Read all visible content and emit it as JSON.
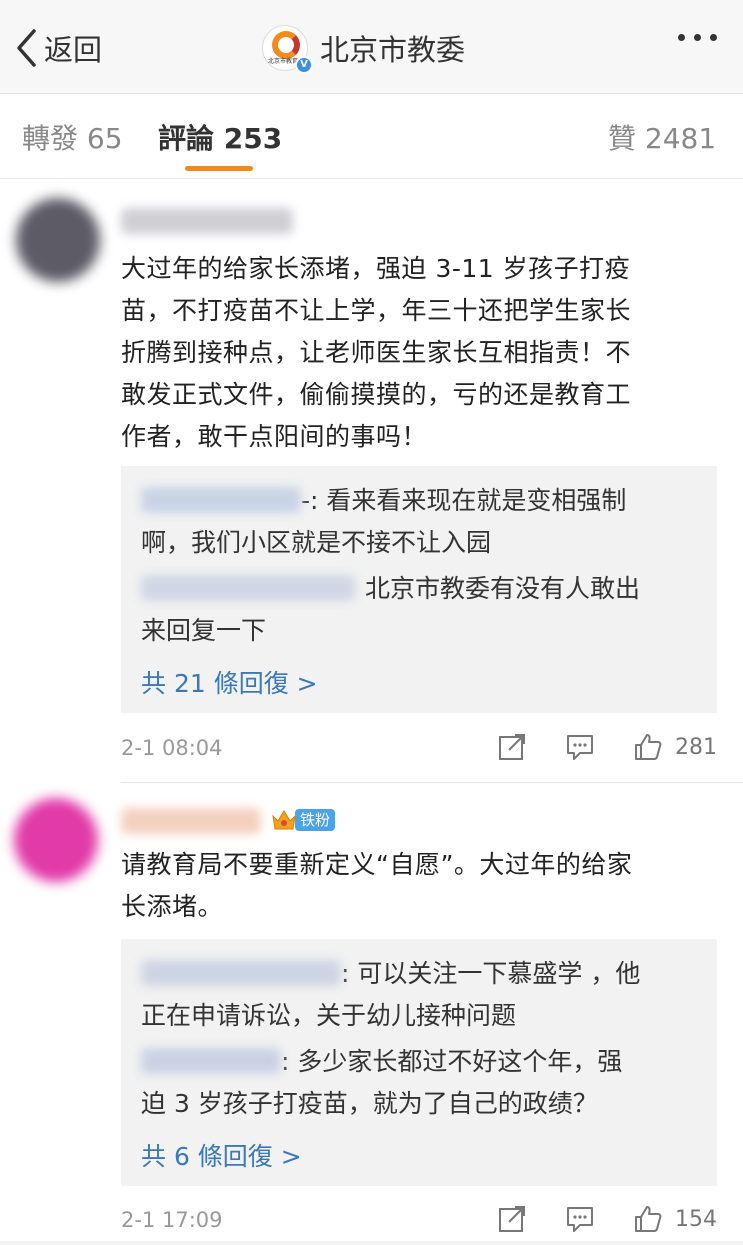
{
  "nav": {
    "back_label": "返回",
    "title": "北京市教委",
    "logo_caption": "北京市教育委",
    "verified_mark": "V"
  },
  "tabs": [
    {
      "label": "轉發",
      "count": "65"
    },
    {
      "label": "評論",
      "count": "253"
    },
    {
      "label": "贊",
      "count": "2481"
    }
  ],
  "comments": [
    {
      "text_lines": [
        "大过年的给家长添堵，强迫 3-11 岁孩子打疫",
        "苗，不打疫苗不让上学，年三十还把学生家长",
        "折腾到接种点，让老师医生家长互相指责！不",
        "敢发正式文件，偷偷摸摸的，亏的还是教育工",
        "作者，敢干点阳间的事吗！"
      ],
      "replies": [
        {
          "line1": "-: 看来看来现在就是变相强制",
          "line2": "啊，我们小区就是不接不让入园"
        },
        {
          "line1": "北京市教委有没有人敢出",
          "line2": "来回复一下"
        }
      ],
      "more_replies": "共 21 條回復 >",
      "timestamp": "2-1 08:04",
      "likes": "281"
    },
    {
      "badge": "铁粉",
      "text_lines": [
        "请教育局不要重新定义“自愿”。大过年的给家",
        "长添堵。"
      ],
      "replies": [
        {
          "line1": ": 可以关注一下慕盛学 ，他",
          "line2": "正在申请诉讼，关于幼儿接种问题"
        },
        {
          "line1": ": 多少家长都过不好这个年，强",
          "line2": "迫 3 岁孩子打疫苗，就为了自己的政绩？"
        }
      ],
      "more_replies": "共 6 條回復 >",
      "timestamp": "2-1 17:09",
      "likes": "154"
    }
  ],
  "colors": {
    "accent": "#f28a1e",
    "link": "#3a78b8",
    "badge": "#4aa3e8"
  }
}
